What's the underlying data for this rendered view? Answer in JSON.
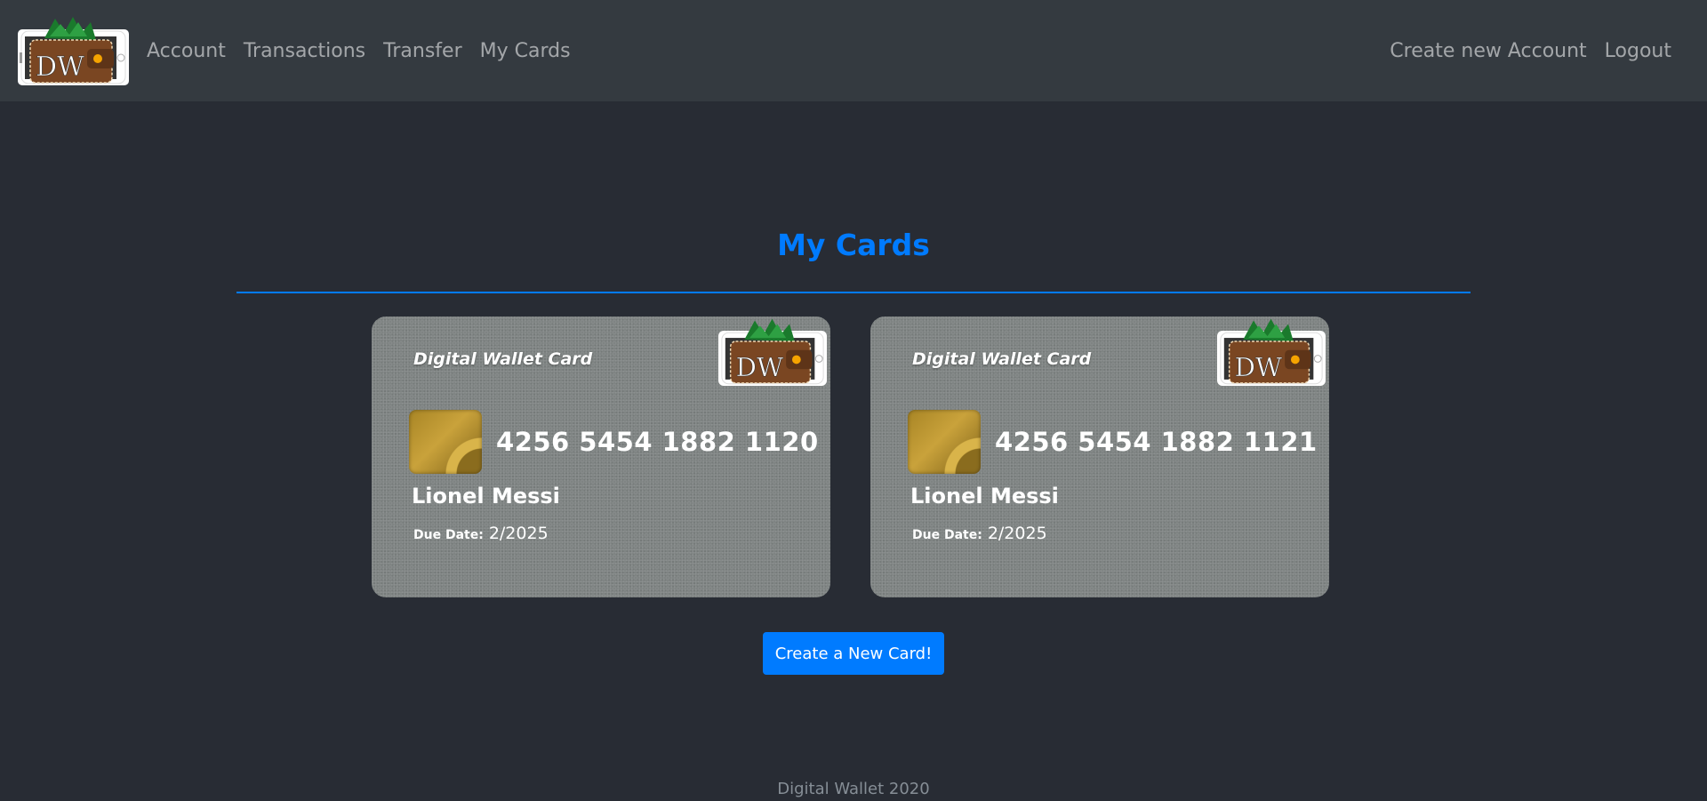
{
  "nav": {
    "left": [
      "Account",
      "Transactions",
      "Transfer",
      "My Cards"
    ],
    "right": [
      "Create new Account",
      "Logout"
    ]
  },
  "page": {
    "title": "My Cards",
    "button_label": "Create a New Card!",
    "footer": "Digital Wallet 2020"
  },
  "cards": [
    {
      "brand": "Digital Wallet Card",
      "number": "4256 5454 1882 1120",
      "holder": "Lionel Messi",
      "due_label": "Due Date:",
      "due_value": "2/2025"
    },
    {
      "brand": "Digital Wallet Card",
      "number": "4256 5454 1882 1121",
      "holder": "Lionel Messi",
      "due_label": "Due Date:",
      "due_value": "2/2025"
    }
  ],
  "logo": {
    "text": "DW"
  },
  "colors": {
    "background": "#282c34",
    "navbar": "#343a40",
    "accent": "#007bff"
  }
}
